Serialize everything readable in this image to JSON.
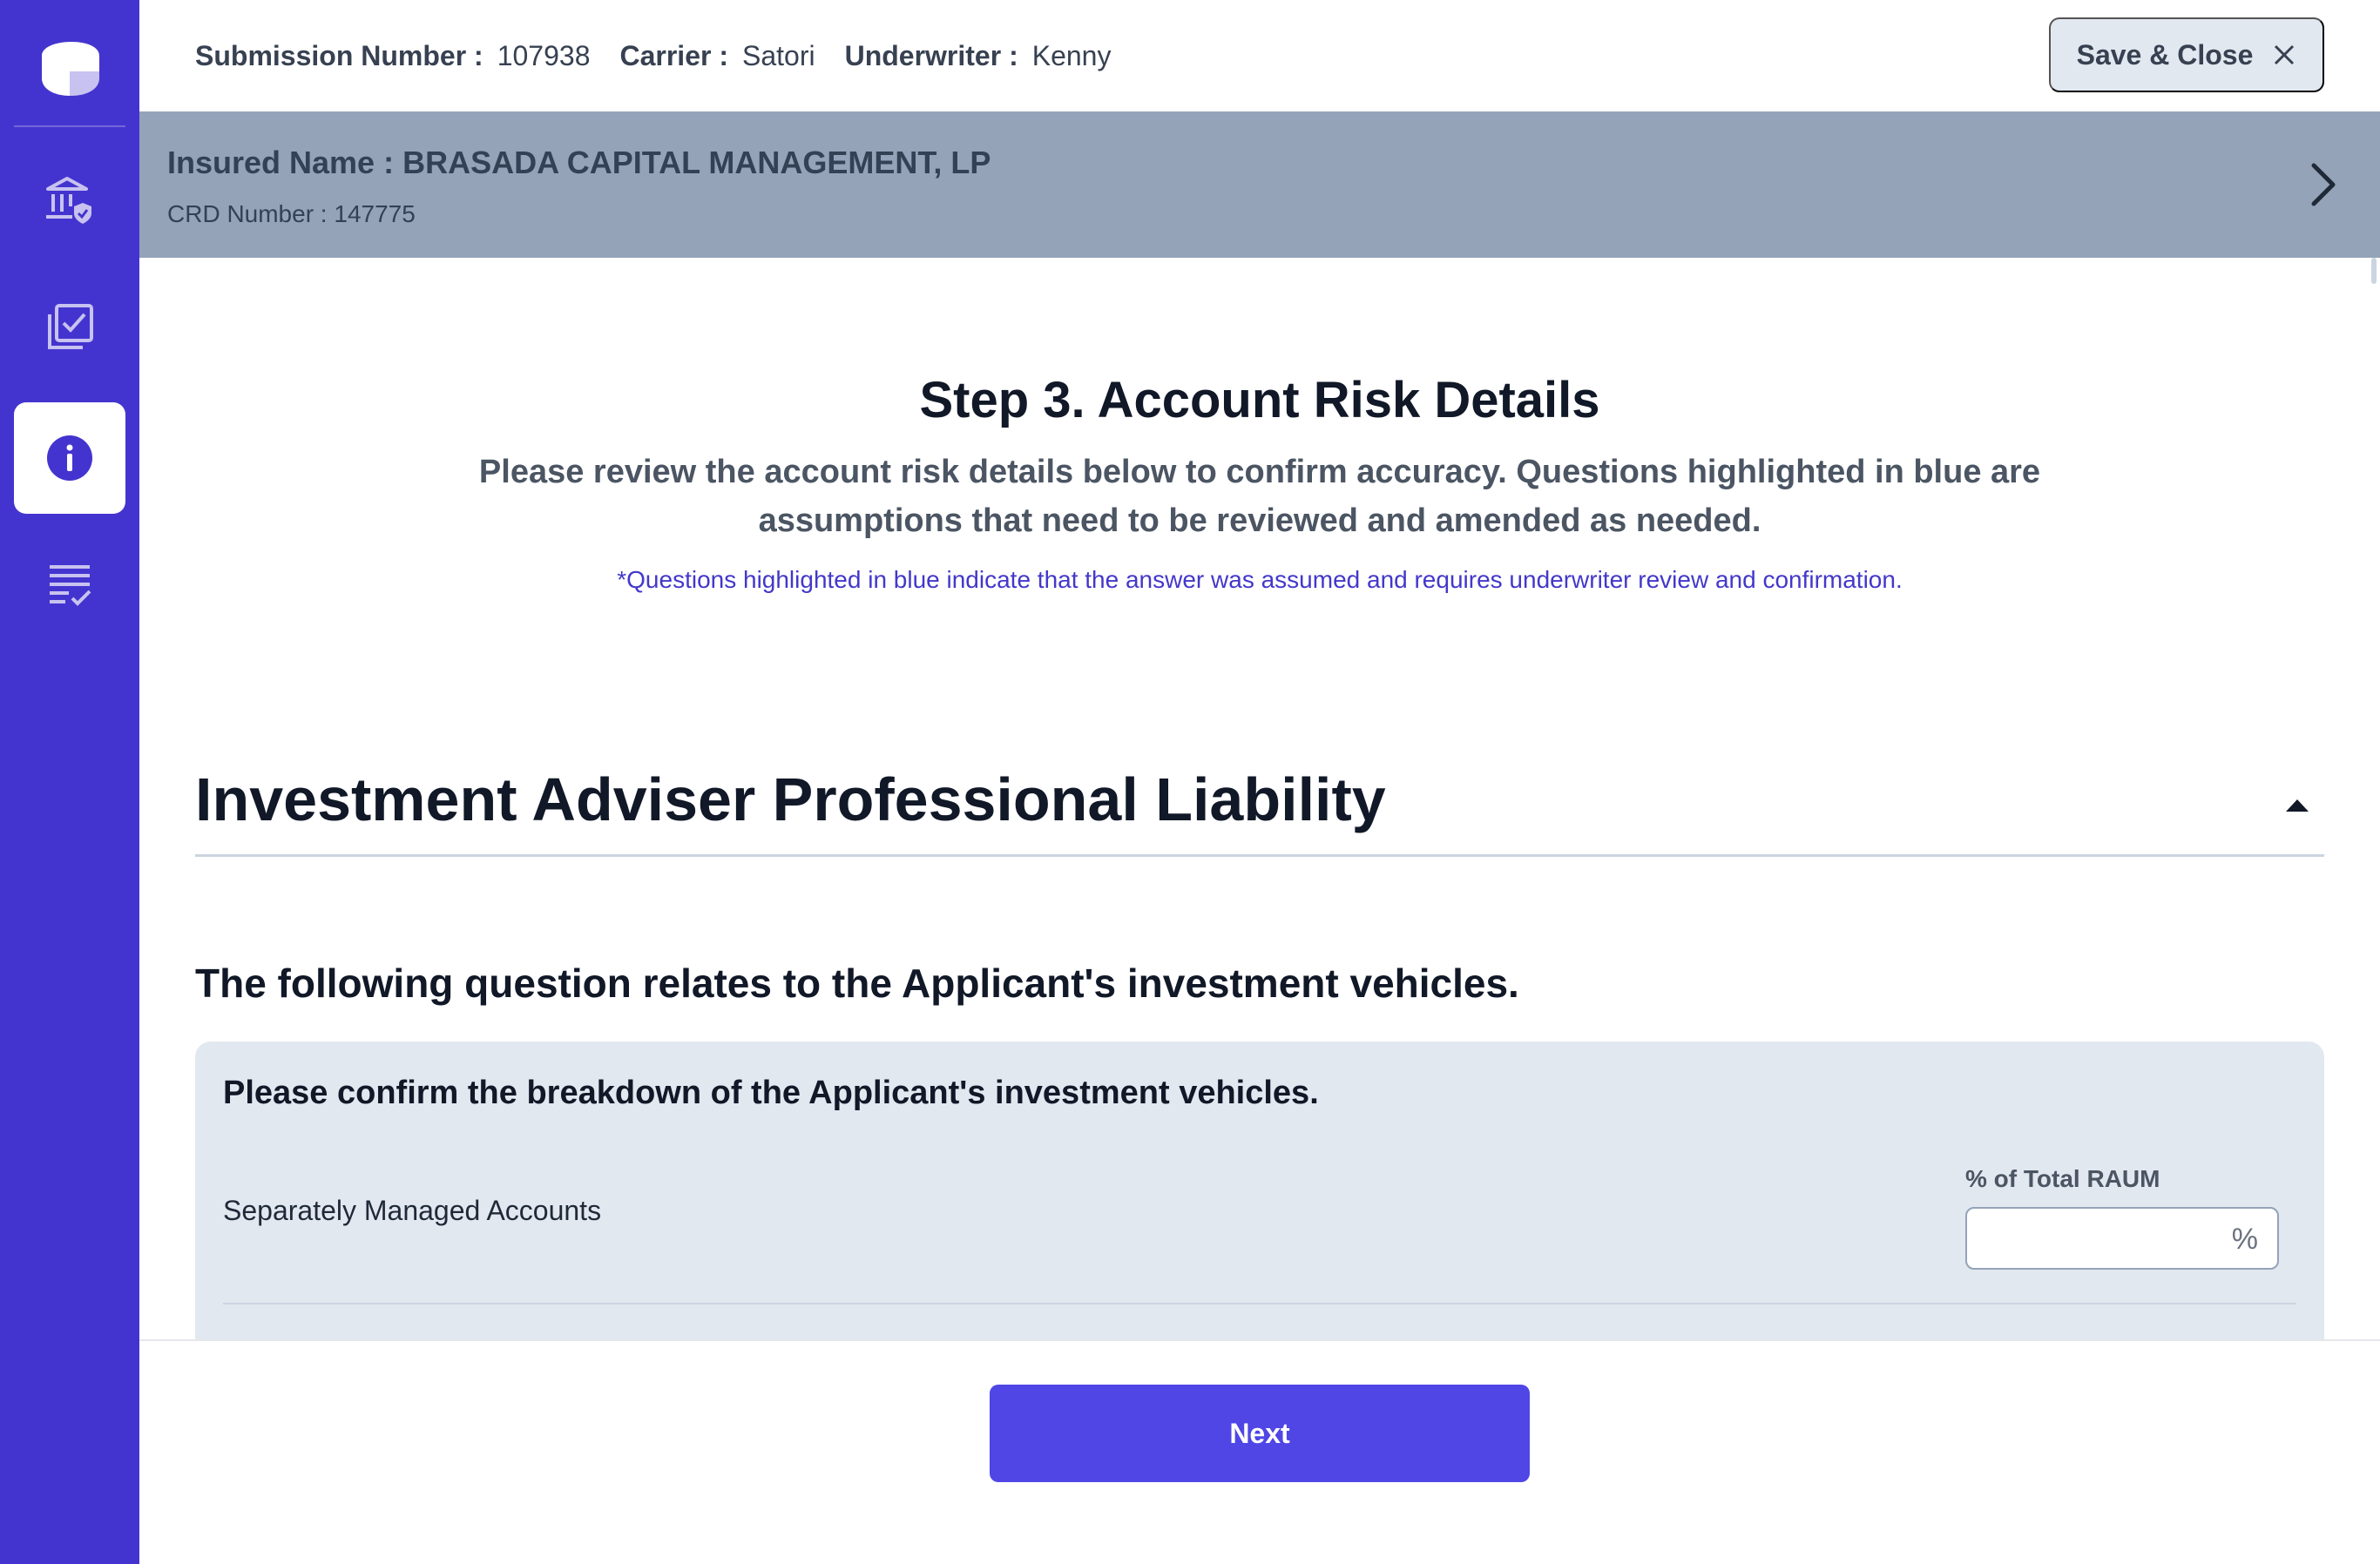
{
  "header": {
    "submission_label": "Submission Number :",
    "submission_value": "107938",
    "carrier_label": "Carrier :",
    "carrier_value": "Satori",
    "underwriter_label": "Underwriter :",
    "underwriter_value": "Kenny",
    "save_close_label": "Save & Close"
  },
  "banner": {
    "insured_name": "Insured Name : BRASADA CAPITAL MANAGEMENT, LP",
    "crd_number": "CRD Number : 147775"
  },
  "sidebar": {
    "items": [
      {
        "icon": "bank-shield-icon",
        "active": false
      },
      {
        "icon": "checklist-copy-icon",
        "active": false
      },
      {
        "icon": "info-icon",
        "active": true
      },
      {
        "icon": "review-list-icon",
        "active": false
      }
    ]
  },
  "step": {
    "title": "Step 3. Account Risk Details",
    "subtitle": "Please review the account risk details below to confirm accuracy. Questions highlighted in blue are assumptions that need to be reviewed and amended as needed.",
    "note": "*Questions highlighted in blue indicate that the answer was assumed and requires underwriter review and confirmation."
  },
  "section": {
    "title": "Investment Adviser Professional Liability",
    "question_lead": "The following question relates to the Applicant's investment vehicles.",
    "card": {
      "question": "Please confirm the breakdown of the Applicant's investment vehicles.",
      "column_header": "% of Total RAUM",
      "row_label": "Separately Managed Accounts",
      "input_value": "",
      "input_suffix": "%"
    }
  },
  "footer": {
    "next_label": "Next"
  },
  "colors": {
    "sidebar": "#4434cf",
    "banner": "#94a3b8",
    "primary_button": "#4f46e5",
    "note_text": "#4338ca"
  }
}
